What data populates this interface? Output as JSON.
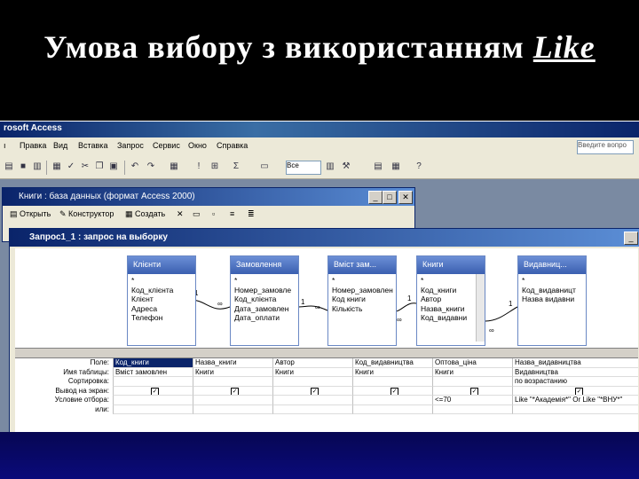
{
  "slide": {
    "title": "Умова вибору з використанням",
    "title_keyword": "Like"
  },
  "app": {
    "title": "rosoft Access",
    "help_placeholder": "Введите вопро"
  },
  "menu": [
    "Правка",
    "Вид",
    "Вставка",
    "Запрос",
    "Сервис",
    "Окно",
    "Справка"
  ],
  "toolbar": {
    "combo_value": "Все"
  },
  "db_window": {
    "title": "Книги : база данных (формат Access 2000)",
    "tools": [
      "Открыть",
      "Конструктор",
      "Создать"
    ]
  },
  "query_window": {
    "title": "Запрос1_1 : запрос на выборку"
  },
  "tables": [
    {
      "name": "Клієнти",
      "fields": [
        "*",
        "Код_клієнта",
        "Клієнт",
        "Адреса",
        "Телефон"
      ]
    },
    {
      "name": "Замовлення",
      "fields": [
        "*",
        "Номер_замовле",
        "Код_клієнта",
        "Дата_замовлен",
        "Дата_оплати"
      ]
    },
    {
      "name": "Вміст зам...",
      "fields": [
        "*",
        "Номер_замовлен",
        "Код книги",
        "Кількість"
      ]
    },
    {
      "name": "Книги",
      "fields": [
        "*",
        "Код_книги",
        "Автор",
        "Назва_книги",
        "Код_видавни"
      ]
    },
    {
      "name": "Видавниц...",
      "fields": [
        "*",
        "Код_видавницт",
        "Назва видавни"
      ]
    }
  ],
  "relations": [
    "1",
    "∞",
    "1",
    "∞",
    "∞",
    "1",
    "1",
    "∞"
  ],
  "grid": {
    "row_labels": [
      "Поле:",
      "Имя таблицы:",
      "Сортировка:",
      "Вывод на экран:",
      "Условие отбора:",
      "или:"
    ],
    "columns": [
      {
        "field": "Код_книги",
        "table": "Вміст замовлен",
        "show": true,
        "criteria": ""
      },
      {
        "field": "Назва_книги",
        "table": "Книги",
        "show": true,
        "criteria": ""
      },
      {
        "field": "Автор",
        "table": "Книги",
        "show": true,
        "criteria": ""
      },
      {
        "field": "Код_видавництва",
        "table": "Книги",
        "show": true,
        "criteria": ""
      },
      {
        "field": "Оптова_ціна",
        "table": "Книги",
        "show": true,
        "criteria": "<=70"
      },
      {
        "field": "Назва_видавництва",
        "table": "Видавництва",
        "sort": "по возрастанию",
        "show": true,
        "criteria": "Like \"*Академія*\" Or Like \"*ВНУ*\""
      }
    ]
  }
}
